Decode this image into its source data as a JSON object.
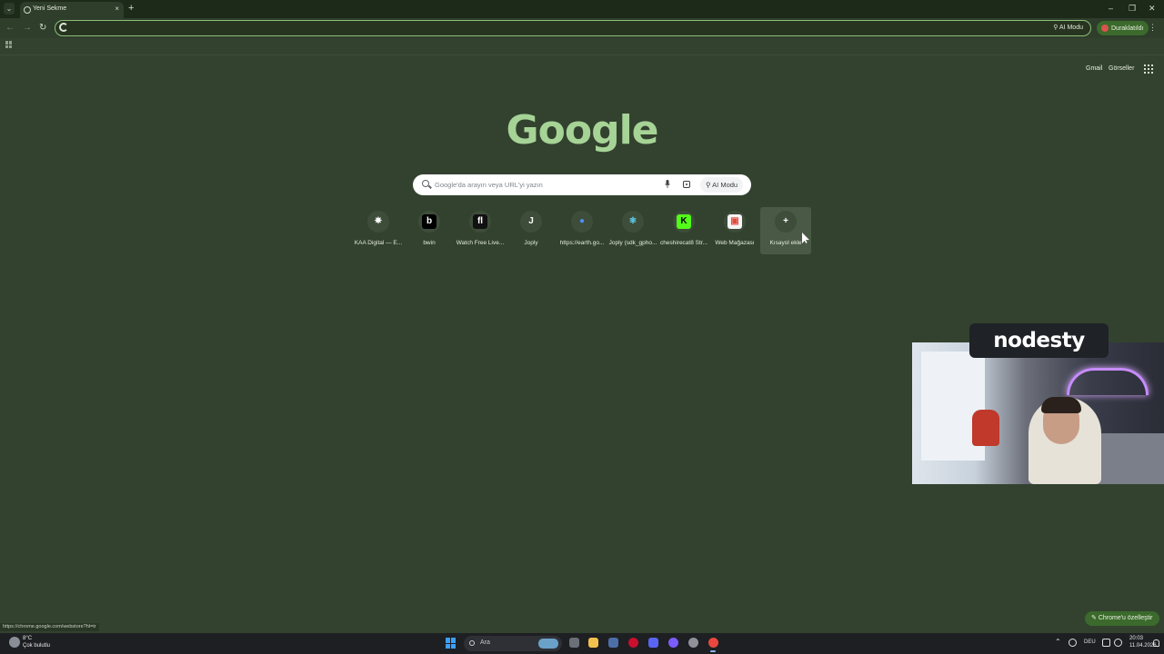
{
  "browser": {
    "tab": {
      "title": "Yeni Sekme",
      "close_glyph": "×"
    },
    "tab_list_glyph": "⌄",
    "new_tab_glyph": "+",
    "window_controls": {
      "minimize": "–",
      "maximize": "❐",
      "close": "✕"
    },
    "nav": {
      "back": "←",
      "forward": "→",
      "reload": "↻"
    },
    "omnibox": {
      "value": "",
      "ai_mode_label": "AI Modu"
    },
    "paused_label": "Duraklatıldı",
    "menu_glyph": "⋮"
  },
  "top_links": {
    "gmail": "Gmail",
    "images": "Görseller"
  },
  "logo": {
    "text": "Google",
    "color": "#a6d396"
  },
  "search": {
    "placeholder": "Google'da arayın veya URL'yi yazın",
    "ai_mode_label": "AI Modu"
  },
  "shortcuts": [
    {
      "label": "KAA Digital — E...",
      "icon": "kaa-icon",
      "glyph": "✵",
      "color": "#ffffff",
      "bg": "transparent"
    },
    {
      "label": "bwin",
      "icon": "bwin-icon",
      "glyph": "b",
      "color": "#ffffff",
      "bg": "#000000"
    },
    {
      "label": "Watch Free Live...",
      "icon": "watch-icon",
      "glyph": "fl",
      "color": "#ffffff",
      "bg": "#111111"
    },
    {
      "label": "Joply",
      "icon": "joply-icon",
      "glyph": "J",
      "color": "#ffffff",
      "bg": "transparent"
    },
    {
      "label": "https://earth.go...",
      "icon": "google-earth-icon",
      "glyph": "●",
      "color": "#4e8df5",
      "bg": "transparent"
    },
    {
      "label": "Joply (sdk_gpho...",
      "icon": "react-icon",
      "glyph": "⚛",
      "color": "#61dafb",
      "bg": "transparent"
    },
    {
      "label": "cheshirecat8 Str...",
      "icon": "kick-icon",
      "glyph": "K",
      "color": "#000000",
      "bg": "#53fc18"
    },
    {
      "label": "Web Mağazası",
      "icon": "webstore-icon",
      "glyph": "▣",
      "color": "#e24a3b",
      "bg": "#f5f5f5"
    },
    {
      "label": "Kısayol ekle",
      "icon": "plus-icon",
      "glyph": "+",
      "color": "#ffffff",
      "bg": "transparent"
    }
  ],
  "overlay": {
    "streamer_name": "nodesty"
  },
  "customize_label": "Chrome'u özelleştir",
  "status_url": "https://chrome.google.com/webstore?hl=tr",
  "taskbar": {
    "weather_temp": "8°C",
    "weather_desc": "Çok bulutlu",
    "search_label": "Ara",
    "language": "DEU",
    "time": "20:03",
    "date": "11.04.2026"
  },
  "colors": {
    "page_bg": "#33422f",
    "accent": "#8cc07a",
    "chip_bg": "#3b6a2c"
  }
}
